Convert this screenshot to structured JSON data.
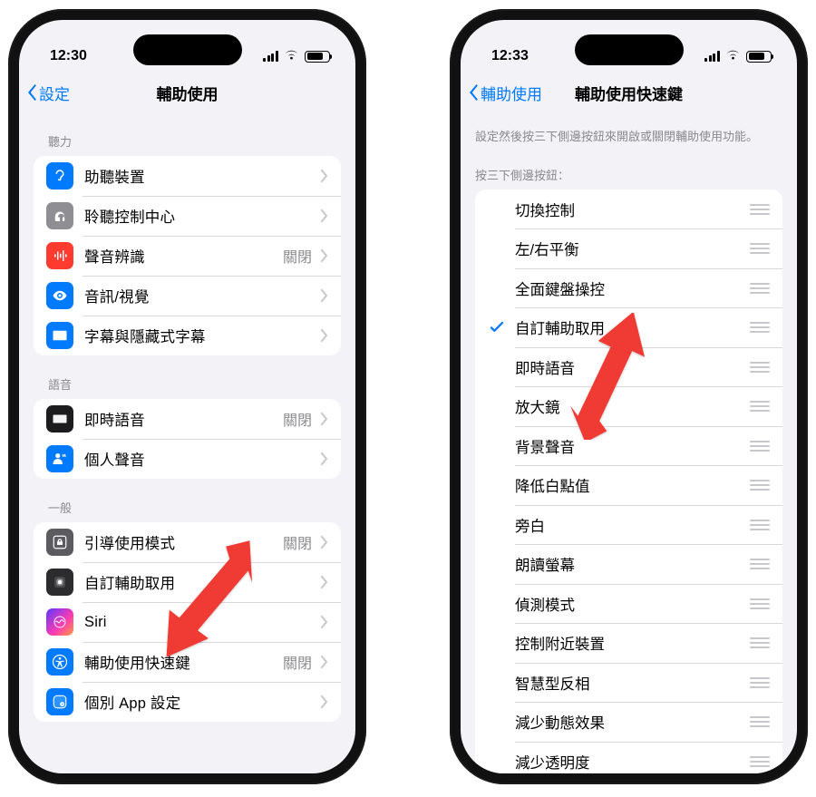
{
  "left": {
    "time": "12:30",
    "nav": {
      "back": "設定",
      "title": "輔助使用"
    },
    "sections": [
      {
        "header": "聽力",
        "rows": [
          {
            "icon": "ear-icon",
            "iconClass": "bg-blue fg-white",
            "title": "助聽裝置",
            "value": ""
          },
          {
            "icon": "headphones-icon",
            "iconClass": "bg-gray fg-white",
            "title": "聆聽控制中心",
            "value": ""
          },
          {
            "icon": "waveform-icon",
            "iconClass": "bg-red fg-white",
            "title": "聲音辨識",
            "value": "關閉"
          },
          {
            "icon": "eye-icon",
            "iconClass": "bg-blue fg-white",
            "title": "音訊/視覺",
            "value": ""
          },
          {
            "icon": "caption-icon",
            "iconClass": "bg-blue fg-white",
            "title": "字幕與隱藏式字幕",
            "value": ""
          }
        ]
      },
      {
        "header": "語音",
        "rows": [
          {
            "icon": "keyboard-icon",
            "iconClass": "bg-black fg-white",
            "title": "即時語音",
            "value": "關閉"
          },
          {
            "icon": "person-voice-icon",
            "iconClass": "bg-blue fg-white",
            "title": "個人聲音",
            "value": ""
          }
        ]
      },
      {
        "header": "一般",
        "rows": [
          {
            "icon": "lock-square-icon",
            "iconClass": "bg-dgray fg-white",
            "title": "引導使用模式",
            "value": "關閉"
          },
          {
            "icon": "assistive-icon",
            "iconClass": "bg-dark2 fg-white",
            "title": "自訂輔助取用",
            "value": ""
          },
          {
            "icon": "siri-icon",
            "iconClass": "bg-siri fg-white",
            "title": "Siri",
            "value": ""
          },
          {
            "icon": "accessibility-icon",
            "iconClass": "bg-blue fg-white",
            "title": "輔助使用快速鍵",
            "value": "關閉"
          },
          {
            "icon": "app-settings-icon",
            "iconClass": "bg-blue fg-white",
            "title": "個別 App 設定",
            "value": ""
          }
        ]
      }
    ]
  },
  "right": {
    "time": "12:33",
    "nav": {
      "back": "輔助使用",
      "title": "輔助使用快速鍵"
    },
    "description": "設定然後按三下側邊按鈕來開啟或關閉輔助使用功能。",
    "listHeader": "按三下側邊按鈕：",
    "items": [
      {
        "title": "切換控制",
        "checked": false
      },
      {
        "title": "左/右平衡",
        "checked": false
      },
      {
        "title": "全面鍵盤操控",
        "checked": false
      },
      {
        "title": "自訂輔助取用",
        "checked": true
      },
      {
        "title": "即時語音",
        "checked": false
      },
      {
        "title": "放大鏡",
        "checked": false
      },
      {
        "title": "背景聲音",
        "checked": false
      },
      {
        "title": "降低白點值",
        "checked": false
      },
      {
        "title": "旁白",
        "checked": false
      },
      {
        "title": "朗讀螢幕",
        "checked": false
      },
      {
        "title": "偵測模式",
        "checked": false
      },
      {
        "title": "控制附近裝置",
        "checked": false
      },
      {
        "title": "智慧型反相",
        "checked": false
      },
      {
        "title": "減少動態效果",
        "checked": false
      },
      {
        "title": "減少透明度",
        "checked": false
      }
    ]
  },
  "colors": {
    "accent": "#007aff",
    "arrow": "#f03b36"
  }
}
